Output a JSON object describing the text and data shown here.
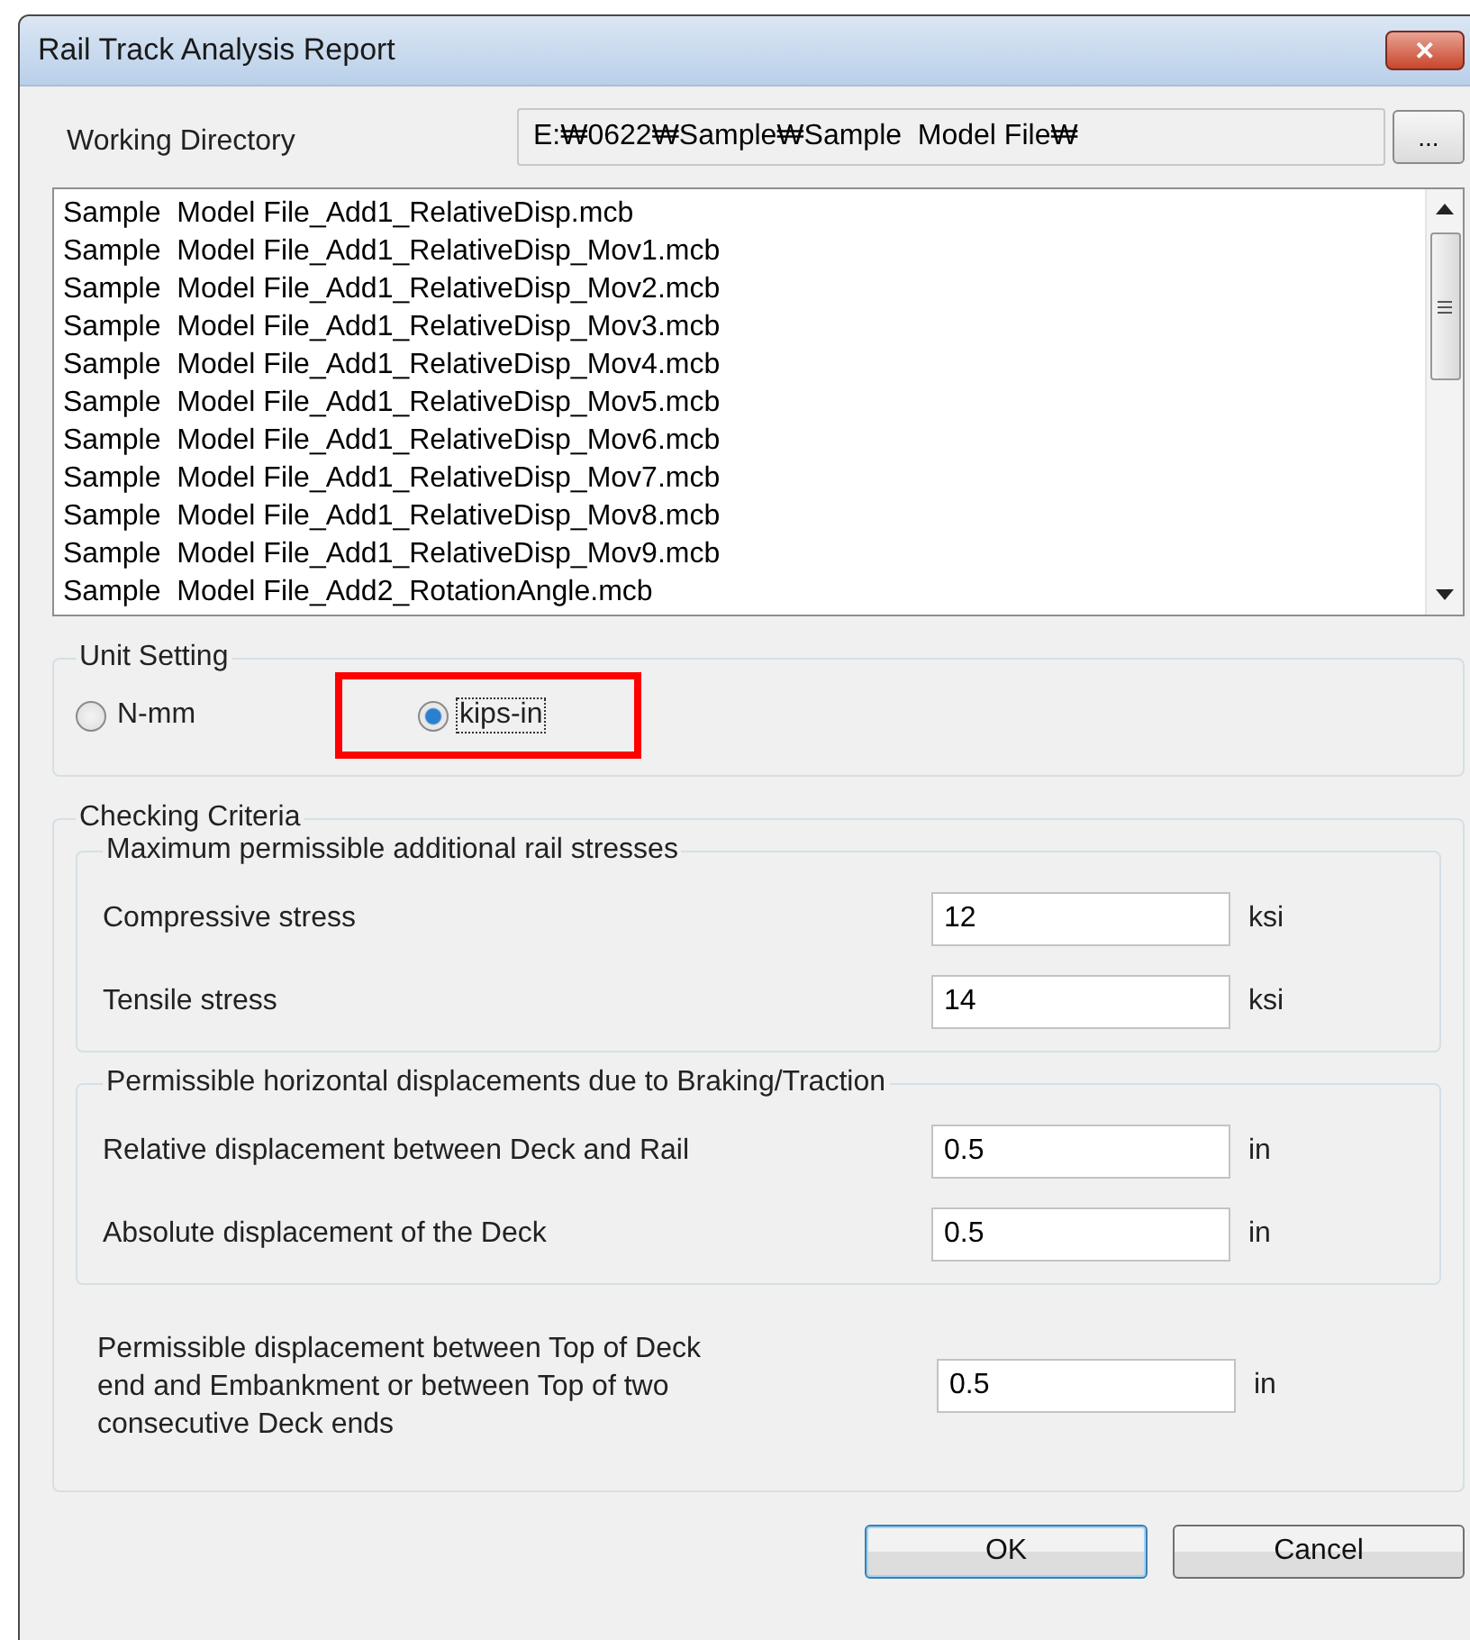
{
  "window": {
    "title": "Rail Track Analysis Report",
    "close": "✕"
  },
  "working_directory": {
    "label": "Working Directory",
    "value": "E:₩0622₩Sample₩Sample  Model File₩",
    "browse_button": "..."
  },
  "files": [
    "Sample  Model File_Add1_RelativeDisp.mcb",
    "Sample  Model File_Add1_RelativeDisp_Mov1.mcb",
    "Sample  Model File_Add1_RelativeDisp_Mov2.mcb",
    "Sample  Model File_Add1_RelativeDisp_Mov3.mcb",
    "Sample  Model File_Add1_RelativeDisp_Mov4.mcb",
    "Sample  Model File_Add1_RelativeDisp_Mov5.mcb",
    "Sample  Model File_Add1_RelativeDisp_Mov6.mcb",
    "Sample  Model File_Add1_RelativeDisp_Mov7.mcb",
    "Sample  Model File_Add1_RelativeDisp_Mov8.mcb",
    "Sample  Model File_Add1_RelativeDisp_Mov9.mcb",
    "Sample  Model File_Add2_RotationAngle.mcb"
  ],
  "unit_setting": {
    "title": "Unit Setting",
    "options": [
      {
        "label": "N-mm",
        "selected": false,
        "focused": false,
        "highlighted": false
      },
      {
        "label": "kips-in",
        "selected": true,
        "focused": true,
        "highlighted": true
      }
    ]
  },
  "checking_criteria": {
    "title": "Checking Criteria",
    "groups": [
      {
        "title": "Maximum permissible additional rail stresses",
        "rows": [
          {
            "label": "Compressive stress",
            "value": "12",
            "unit": "ksi"
          },
          {
            "label": "Tensile stress",
            "value": "14",
            "unit": "ksi"
          }
        ]
      },
      {
        "title": "Permissible horizontal displacements due to Braking/Traction",
        "rows": [
          {
            "label": "Relative displacement between Deck and Rail",
            "value": "0.5",
            "unit": "in"
          },
          {
            "label": "Absolute displacement of the Deck",
            "value": "0.5",
            "unit": "in"
          }
        ]
      }
    ],
    "extra_row": {
      "label": "Permissible displacement between Top of Deck end and Embankment or between Top of two consecutive Deck ends",
      "value": "0.5",
      "unit": "in"
    }
  },
  "buttons": [
    {
      "label": "OK",
      "default": true
    },
    {
      "label": "Cancel",
      "default": false
    }
  ]
}
